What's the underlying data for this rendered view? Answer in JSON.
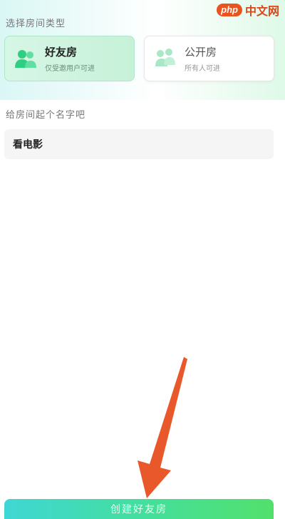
{
  "watermark": {
    "badge": "php",
    "text": "中文网"
  },
  "room_type": {
    "title": "选择房间类型",
    "options": [
      {
        "label": "好友房",
        "subtitle": "仅受邀用户可进",
        "selected": true,
        "icon": "friends-icon"
      },
      {
        "label": "公开房",
        "subtitle": "所有人可进",
        "selected": false,
        "icon": "public-room-icon"
      }
    ]
  },
  "room_name": {
    "title": "给房间起个名字吧",
    "value": "看电影"
  },
  "submit": {
    "label": "创建好友房"
  },
  "annotation": {
    "icon": "red-arrow-icon",
    "color": "#e8582a"
  },
  "colors": {
    "accent_green": "#45df9a",
    "accent_teal": "#3fd7d4",
    "selected_card_bg": "#d7f6e6"
  }
}
